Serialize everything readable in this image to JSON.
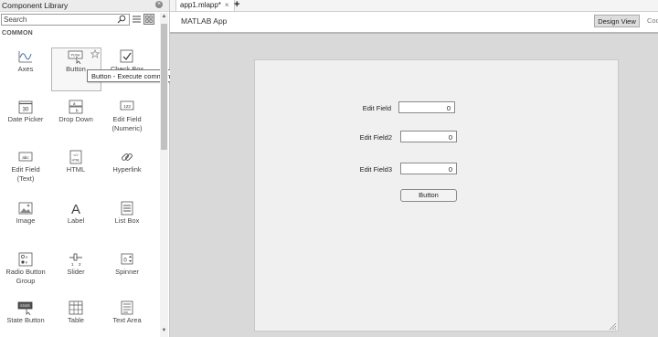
{
  "library": {
    "title": "Component Library",
    "search_placeholder": "Search",
    "section": "COMMON",
    "tooltip": "Button - Execute command when pressed",
    "components": [
      {
        "label": "Axes",
        "icon": "axes-icon"
      },
      {
        "label": "Button",
        "icon": "push-button-icon"
      },
      {
        "label": "Check Box",
        "icon": "checkbox-icon"
      },
      {
        "label": "Date Picker",
        "icon": "calendar-icon"
      },
      {
        "label": "Drop Down",
        "icon": "dropdown-icon"
      },
      {
        "label": "Edit Field\n(Numeric)",
        "icon": "numeric-field-icon"
      },
      {
        "label": "Edit Field\n(Text)",
        "icon": "text-field-icon"
      },
      {
        "label": "HTML",
        "icon": "html-icon"
      },
      {
        "label": "Hyperlink",
        "icon": "link-icon"
      },
      {
        "label": "Image",
        "icon": "image-icon"
      },
      {
        "label": "Label",
        "icon": "label-icon"
      },
      {
        "label": "List Box",
        "icon": "listbox-icon"
      },
      {
        "label": "Radio Button\nGroup",
        "icon": "radio-group-icon"
      },
      {
        "label": "Slider",
        "icon": "slider-icon"
      },
      {
        "label": "Spinner",
        "icon": "spinner-icon"
      },
      {
        "label": "State Button",
        "icon": "state-button-icon"
      },
      {
        "label": "Table",
        "icon": "table-icon"
      },
      {
        "label": "Text Area",
        "icon": "text-area-icon"
      }
    ]
  },
  "tabs": {
    "doc": "app1.mlapp*",
    "close": "×",
    "add": "+"
  },
  "app": {
    "title": "MATLAB App",
    "design_view": "Design View",
    "code_view": "Code View"
  },
  "figure": {
    "fields": [
      {
        "label": "Edit Field",
        "value": "0"
      },
      {
        "label": "Edit Field2",
        "value": "0"
      },
      {
        "label": "Edit Field3",
        "value": "0"
      }
    ],
    "button": "Button"
  },
  "colors": {
    "canvas": "#d9d9d9",
    "figure": "#f0f0f0",
    "icon_stroke": "#555555"
  }
}
